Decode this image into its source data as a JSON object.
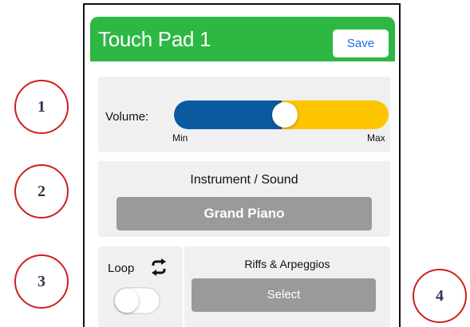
{
  "header": {
    "title": "Touch Pad 1",
    "save_label": "Save"
  },
  "volume": {
    "label": "Volume:",
    "min_label": "Min",
    "max_label": "Max",
    "level": 0.5
  },
  "instrument": {
    "title": "Instrument / Sound",
    "selected": "Grand Piano"
  },
  "loop": {
    "label": "Loop",
    "icon": "loop-icon",
    "enabled": false
  },
  "riffs": {
    "title": "Riffs & Arpeggios",
    "button_label": "Select"
  },
  "callouts": [
    "1",
    "2",
    "3",
    "4"
  ],
  "colors": {
    "header": "#2db843",
    "slider_fill": "#0a5aa0",
    "slider_rest": "#fdc500",
    "button_gray": "#9a9a9a",
    "callout_ring": "#cc1f1f",
    "save_text": "#1a6fe0"
  }
}
